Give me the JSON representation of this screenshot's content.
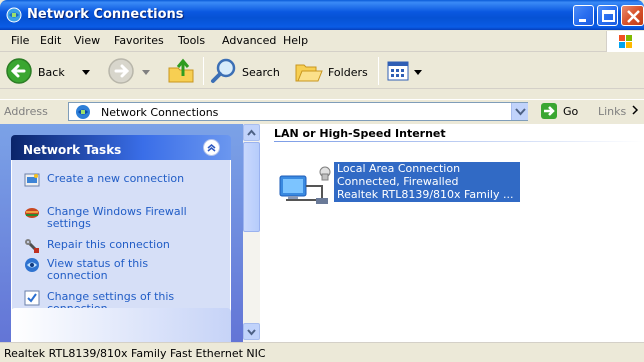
{
  "window": {
    "title": "Network Connections"
  },
  "menu": {
    "file": "File",
    "edit": "Edit",
    "view": "View",
    "favorites": "Favorites",
    "tools": "Tools",
    "advanced": "Advanced",
    "help": "Help"
  },
  "toolbar": {
    "back": "Back",
    "search": "Search",
    "folders": "Folders"
  },
  "address": {
    "label": "Address",
    "value": "Network Connections",
    "go": "Go",
    "links": "Links"
  },
  "tasks": {
    "title": "Network Tasks",
    "items": [
      {
        "label": "Create a new connection",
        "icon": "new-connection-icon"
      },
      {
        "label": "Change Windows Firewall settings",
        "icon": "firewall-icon"
      },
      {
        "label": "Repair this connection",
        "icon": "repair-icon"
      },
      {
        "label": "View status of this connection",
        "icon": "status-icon"
      },
      {
        "label": "Change settings of this connection",
        "icon": "settings-icon"
      }
    ]
  },
  "content": {
    "group_title": "LAN or High-Speed Internet",
    "connection": {
      "name": "Local Area Connection",
      "status": "Connected, Firewalled",
      "device": "Realtek RTL8139/810x Family ..."
    }
  },
  "statusbar": {
    "text": "Realtek RTL8139/810x Family Fast Ethernet NIC"
  },
  "colors": {
    "title_blue": "#0a58e0",
    "task_link": "#215dc6",
    "selection": "#316ac5"
  }
}
